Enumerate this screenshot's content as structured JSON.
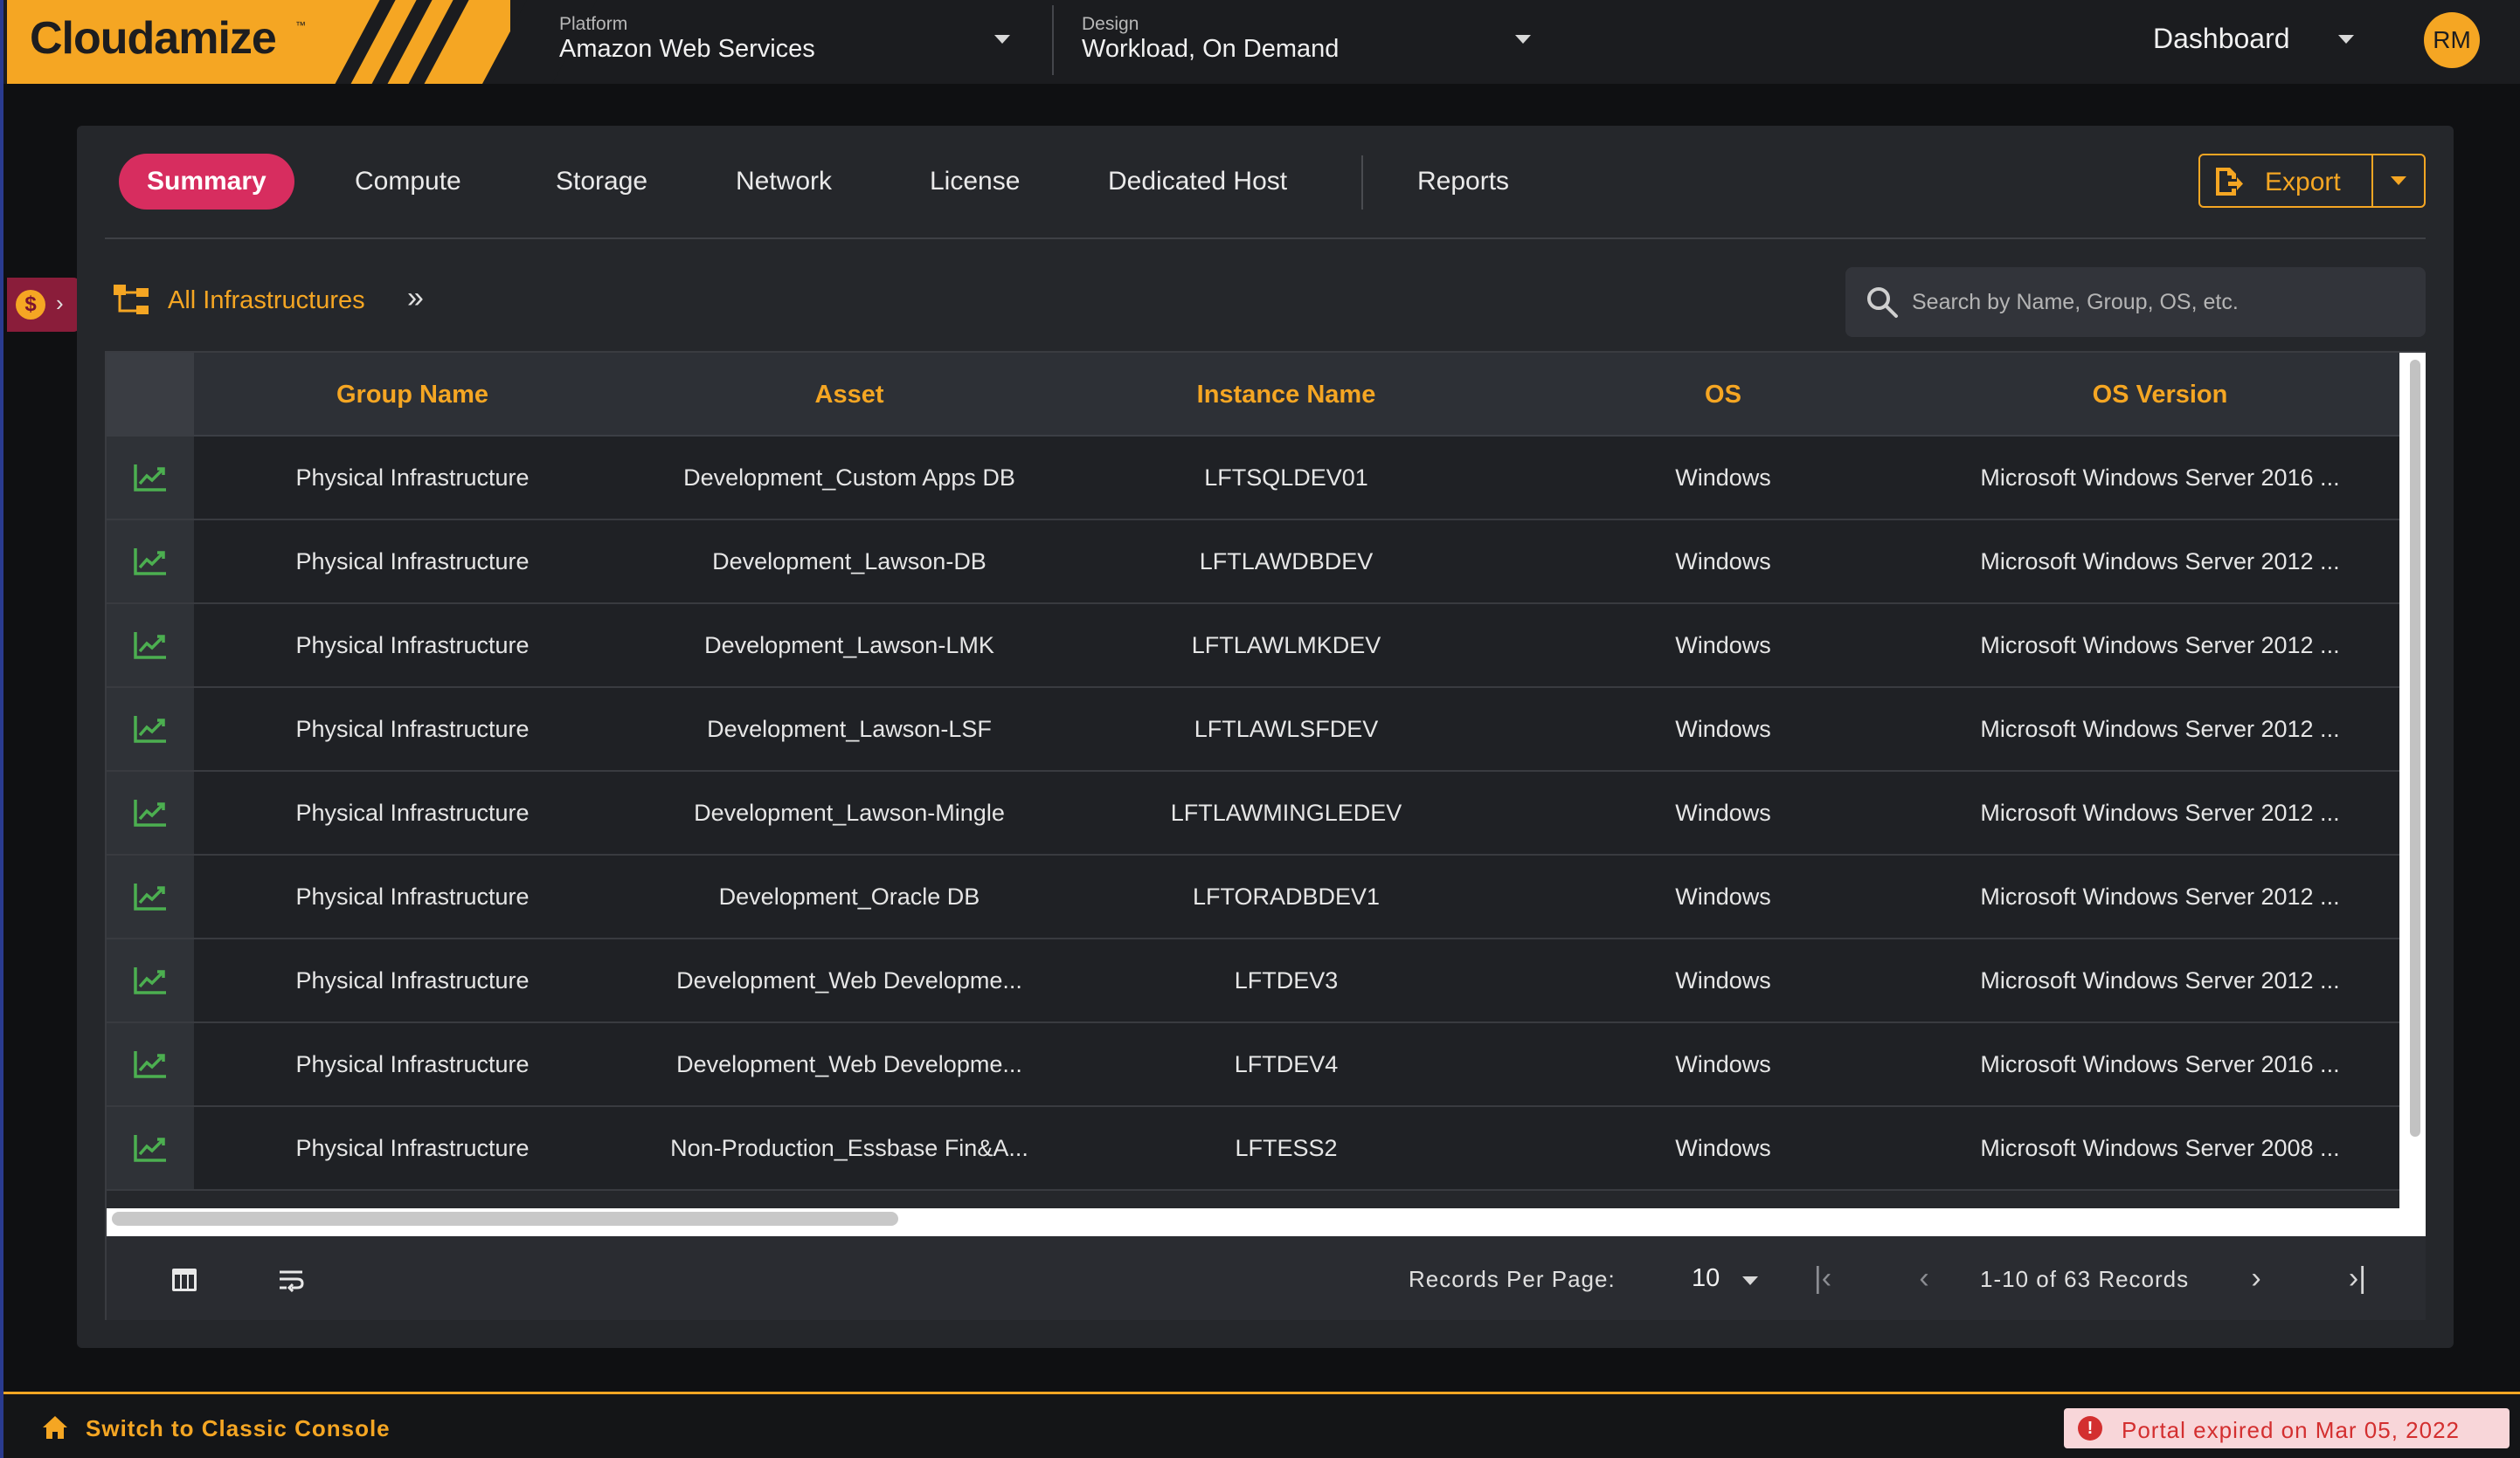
{
  "app": {
    "logo": "Cloudamize",
    "logo_tm": "™"
  },
  "topbar": {
    "platform_label": "Platform",
    "platform_value": "Amazon Web Services",
    "design_label": "Design",
    "design_value": "Workload, On Demand",
    "view_select": "Dashboard",
    "avatar_initials": "RM"
  },
  "tabs": [
    "Summary",
    "Compute",
    "Storage",
    "Network",
    "License",
    "Dedicated Host",
    "Reports"
  ],
  "export_label": "Export",
  "breadcrumb": "All Infrastructures",
  "search": {
    "placeholder": "Search by Name, Group, OS, etc."
  },
  "table": {
    "columns": [
      "Group Name",
      "Asset",
      "Instance Name",
      "OS",
      "OS Version"
    ],
    "rows": [
      [
        "Physical Infrastructure",
        "Development_Custom Apps DB",
        "LFTSQLDEV01",
        "Windows",
        "Microsoft Windows Server 2016 ..."
      ],
      [
        "Physical Infrastructure",
        "Development_Lawson-DB",
        "LFTLAWDBDEV",
        "Windows",
        "Microsoft Windows Server 2012 ..."
      ],
      [
        "Physical Infrastructure",
        "Development_Lawson-LMK",
        "LFTLAWLMKDEV",
        "Windows",
        "Microsoft Windows Server 2012 ..."
      ],
      [
        "Physical Infrastructure",
        "Development_Lawson-LSF",
        "LFTLAWLSFDEV",
        "Windows",
        "Microsoft Windows Server 2012 ..."
      ],
      [
        "Physical Infrastructure",
        "Development_Lawson-Mingle",
        "LFTLAWMINGLEDEV",
        "Windows",
        "Microsoft Windows Server 2012 ..."
      ],
      [
        "Physical Infrastructure",
        "Development_Oracle DB",
        "LFTORADBDEV1",
        "Windows",
        "Microsoft Windows Server 2012 ..."
      ],
      [
        "Physical Infrastructure",
        "Development_Web Developme...",
        "LFTDEV3",
        "Windows",
        "Microsoft Windows Server 2012 ..."
      ],
      [
        "Physical Infrastructure",
        "Development_Web Developme...",
        "LFTDEV4",
        "Windows",
        "Microsoft Windows Server 2016 ..."
      ],
      [
        "Physical Infrastructure",
        "Non-Production_Essbase Fin&A...",
        "LFTESS2",
        "Windows",
        "Microsoft Windows Server 2008 ..."
      ]
    ]
  },
  "pagination": {
    "records_per_page_label": "Records Per Page:",
    "records_per_page": "10",
    "info": "1-10 of 63 Records"
  },
  "footer": {
    "classic_console": "Switch to Classic Console",
    "expired": "Portal expired on Mar 05, 2022"
  },
  "colors": {
    "accent": "#f5a623",
    "active_tab": "#d72d5f",
    "trend_icon": "#4caf50",
    "alert": "#d32f2f"
  },
  "icons": [
    "dollar-icon",
    "chevron-right-icon",
    "hierarchy-icon",
    "double-chevron-icon",
    "search-icon",
    "export-file-icon",
    "trend-chart-icon",
    "table-layout-icon",
    "wrap-text-icon",
    "first-page-icon",
    "prev-page-icon",
    "next-page-icon",
    "last-page-icon",
    "home-icon",
    "info-icon"
  ]
}
